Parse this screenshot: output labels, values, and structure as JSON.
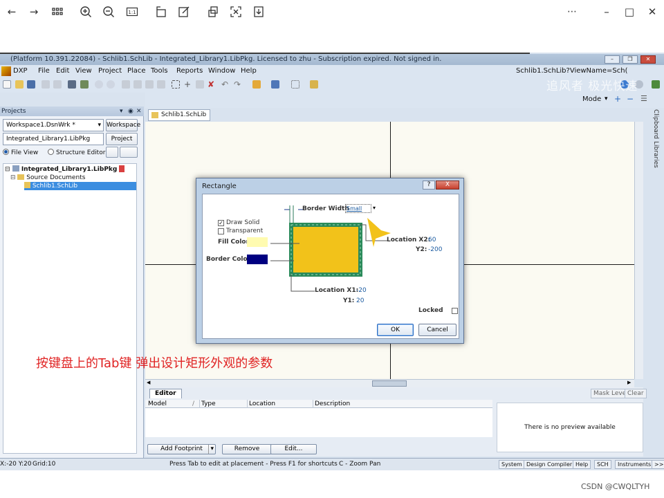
{
  "window": {
    "title": "(Platform 10.391.22084) - Schlib1.SchLib - Integrated_Library1.LibPkg. Licensed to zhu - Subscription expired. Not signed in."
  },
  "menu": {
    "dxp": "DXP",
    "items": [
      "File",
      "Edit",
      "View",
      "Project",
      "Place",
      "Tools",
      "Reports",
      "Window",
      "Help"
    ],
    "view_name": "Schlib1.SchLib?ViewName=Sch(",
    "mode": "Mode"
  },
  "projects_panel": {
    "title": "Projects",
    "workspace_value": "Workspace1.DsnWrk *",
    "workspace_button": "Workspace",
    "project_value": "Integrated_Library1.LibPkg",
    "project_button": "Project",
    "file_view": "File View",
    "structure_editor": "Structure Editor",
    "tree": [
      "Integrated_Library1.LibPkg *",
      "Source Documents",
      "Schlib1.SchLib"
    ]
  },
  "document": {
    "tab": "Schlib1.SchLib",
    "side_tabs": [
      "Clipboard",
      "Libraries"
    ]
  },
  "dialog": {
    "title": "Rectangle",
    "help": "?",
    "close": "X",
    "border_width_label": "Border Width",
    "border_width_value": "Small",
    "draw_solid": "Draw Solid",
    "transparent": "Transparent",
    "fill_color_label": "Fill Color",
    "border_color_label": "Border Color",
    "fill_color": "#fffbb0",
    "border_color": "#000080",
    "location_x2_label": "Location  X2:",
    "x2": "60",
    "y2_label": "Y2:",
    "y2": "-200",
    "location_x1_label": "Location  X1:",
    "x1": "-20",
    "y1_label": "Y1:",
    "y1": "20",
    "locked": "Locked",
    "ok": "OK",
    "cancel": "Cancel"
  },
  "caption": "按键盘上的Tab键 弹出设计矩形外观的参数",
  "editor": {
    "tab": "Editor",
    "mask_level": "Mask Level",
    "clear": "Clear",
    "columns": [
      "Model",
      "Type",
      "Location",
      "Description"
    ],
    "preview_text": "There is no preview available",
    "add_footprint": "Add Footprint",
    "remove": "Remove",
    "edit": "Edit..."
  },
  "status": {
    "coords": "X:-20 Y:20",
    "grid": "Grid:10",
    "hint": "Press Tab to edit at placement - Press F1 for shortcuts",
    "mode": "C - Zoom Pan",
    "tabs": [
      "System",
      "Design Compiler",
      "Help",
      "SCH",
      "Instruments",
      ">>"
    ]
  },
  "watermark": "CSDN @CWQLTYH",
  "ghost_watermark": "追风者 极光快速"
}
